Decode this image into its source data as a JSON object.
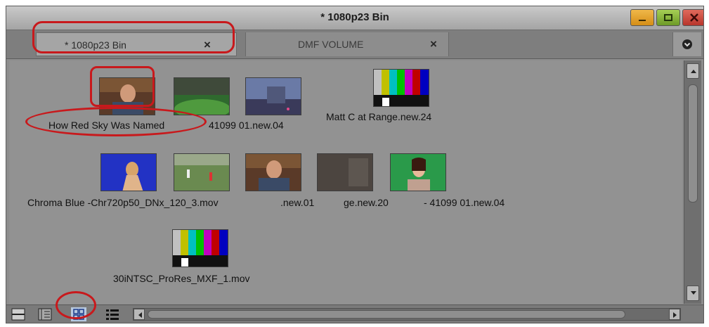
{
  "window": {
    "title": "* 1080p23 Bin"
  },
  "tabs": [
    {
      "label": "* 1080p23 Bin",
      "close": "×",
      "active": true
    },
    {
      "label": "DMF VOLUME",
      "close": "×",
      "active": false
    }
  ],
  "clips": [
    {
      "name": "How Red Sky Was Named",
      "thumb": "man-interview"
    },
    {
      "name": "41099 01.new.04",
      "thumb": "green-field"
    },
    {
      "name": "",
      "thumb": "city-dusk"
    },
    {
      "name": "Matt C at Range.new.24",
      "thumb": "color-bars"
    },
    {
      "name": "Chroma Blue -Chr720p50_DNx_120_3.mov",
      "thumb": "bluescreen-figure"
    },
    {
      "name": "",
      "thumb": "soccer-field"
    },
    {
      "name": ".new.01",
      "thumb": "man-interview"
    },
    {
      "name": "ge.new.20",
      "thumb": "dark-room"
    },
    {
      "name": "- 41099 01.new.04",
      "thumb": "woman-greenscreen"
    },
    {
      "name": "30iNTSC_ProRes_MXF_1.mov",
      "thumb": "color-bars"
    }
  ],
  "view_modes": [
    {
      "icon": "text-view-icon"
    },
    {
      "icon": "frame-script-icon"
    },
    {
      "icon": "frame-view-icon"
    },
    {
      "icon": "list-view-icon"
    }
  ],
  "colors": {
    "accent_ring": "#c8191c",
    "panel": "#929292"
  }
}
